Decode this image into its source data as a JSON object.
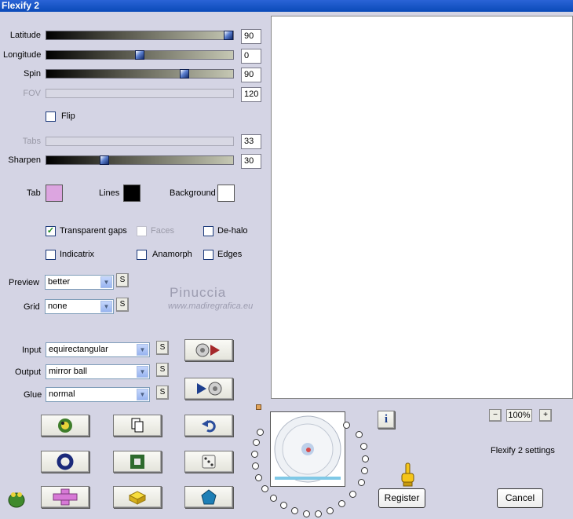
{
  "window": {
    "title": "Flexify 2"
  },
  "sliders": [
    {
      "label": "Latitude",
      "value": "90",
      "fraction": 1.0,
      "enabled": true
    },
    {
      "label": "Longitude",
      "value": "0",
      "fraction": 0.5,
      "enabled": true
    },
    {
      "label": "Spin",
      "value": "90",
      "fraction": 0.75,
      "enabled": true
    },
    {
      "label": "FOV",
      "value": "120",
      "enabled": false
    },
    {
      "label": "Tabs",
      "value": "33",
      "enabled": false
    },
    {
      "label": "Sharpen",
      "value": "30",
      "fraction": 0.3,
      "enabled": true
    }
  ],
  "flip": {
    "label": "Flip",
    "checked": false
  },
  "colors": {
    "tab": {
      "label": "Tab",
      "color": "#dca5e0"
    },
    "lines": {
      "label": "Lines",
      "color": "#000000"
    },
    "background": {
      "label": "Background",
      "color": "#ffffff"
    }
  },
  "checks": {
    "transparent_gaps": {
      "label": "Transparent gaps",
      "checked": true
    },
    "faces": {
      "label": "Faces",
      "checked": false,
      "enabled": false
    },
    "de_halo": {
      "label": "De-halo",
      "checked": false
    },
    "indicatrix": {
      "label": "Indicatrix",
      "checked": false
    },
    "anamorph": {
      "label": "Anamorph",
      "checked": false
    },
    "edges": {
      "label": "Edges",
      "checked": false
    }
  },
  "preview": {
    "label": "Preview",
    "value": "better"
  },
  "grid": {
    "label": "Grid",
    "value": "none"
  },
  "input": {
    "label": "Input",
    "value": "equirectangular"
  },
  "output": {
    "label": "Output",
    "value": "mirror ball"
  },
  "glue": {
    "label": "Glue",
    "value": "normal"
  },
  "s_button": "S",
  "watermark": {
    "name": "Pinuccia",
    "url": "www.madiregrafica.eu"
  },
  "zoom": {
    "value": "100%",
    "minus": "−",
    "plus": "+"
  },
  "settings_label": "Flexify 2 settings",
  "info_label": "i",
  "buttons": {
    "register": "Register",
    "cancel": "Cancel"
  },
  "icons": {
    "convert_right": "disc-arrow-right-icon",
    "convert_left": "arrow-disc-left-icon",
    "frog": "frog-icon",
    "copy": "copy-icon",
    "undo": "undo-icon",
    "ring": "ring-icon",
    "square": "square-icon",
    "dice": "dice-icon",
    "cross": "cross-icon",
    "brick": "brick-icon",
    "pentagon": "pentagon-icon",
    "finger": "pointing-finger-icon"
  }
}
